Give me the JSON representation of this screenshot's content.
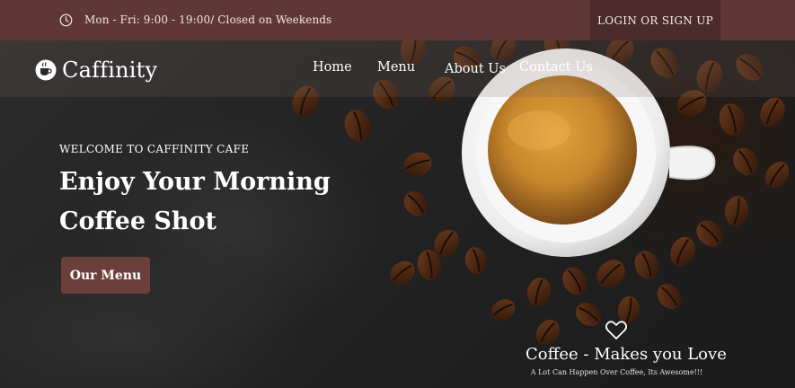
{
  "topbar": {
    "hours_icon": "clock-icon",
    "hours_text": "Mon - Fri: 9:00 - 19:00/ Closed on Weekends",
    "login_label": "LOGIN OR SIGN UP"
  },
  "brand": {
    "logo_icon": "coffee-cup-icon",
    "name": "Caffinity"
  },
  "nav": {
    "items": [
      {
        "label": "Home"
      },
      {
        "label": "Menu"
      },
      {
        "label": "About Us"
      },
      {
        "label": "Contact Us"
      }
    ]
  },
  "hero": {
    "welcome": "WELCOME TO  CAFFINITY CAFE",
    "headline": "Enjoy Your Morning Coffee Shot",
    "cta_label": "Our Menu"
  },
  "tagline": {
    "icon": "heart-icon",
    "title": "Coffee - Makes you Love",
    "subtitle": "A Lot Can Happen Over Coffee, Its Awesome!!!"
  },
  "colors": {
    "topbar_bg": "#5f3835",
    "login_bg": "#4a2b29",
    "cta_bg": "#6b403b",
    "text": "#ffffff"
  }
}
